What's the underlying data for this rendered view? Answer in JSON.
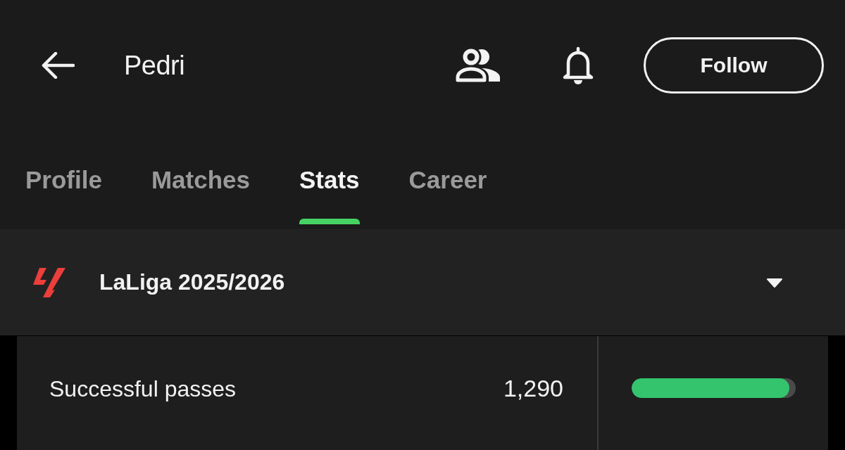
{
  "header": {
    "title": "Pedri",
    "follow_button": "Follow"
  },
  "tabs": [
    {
      "label": "Profile",
      "selected": false
    },
    {
      "label": "Matches",
      "selected": false
    },
    {
      "label": "Stats",
      "selected": true
    },
    {
      "label": "Career",
      "selected": false
    }
  ],
  "competition": {
    "name": "LaLiga 2025/2026"
  },
  "stats": [
    {
      "label": "Successful passes",
      "value": "1,290",
      "level": 0.96
    }
  ]
}
